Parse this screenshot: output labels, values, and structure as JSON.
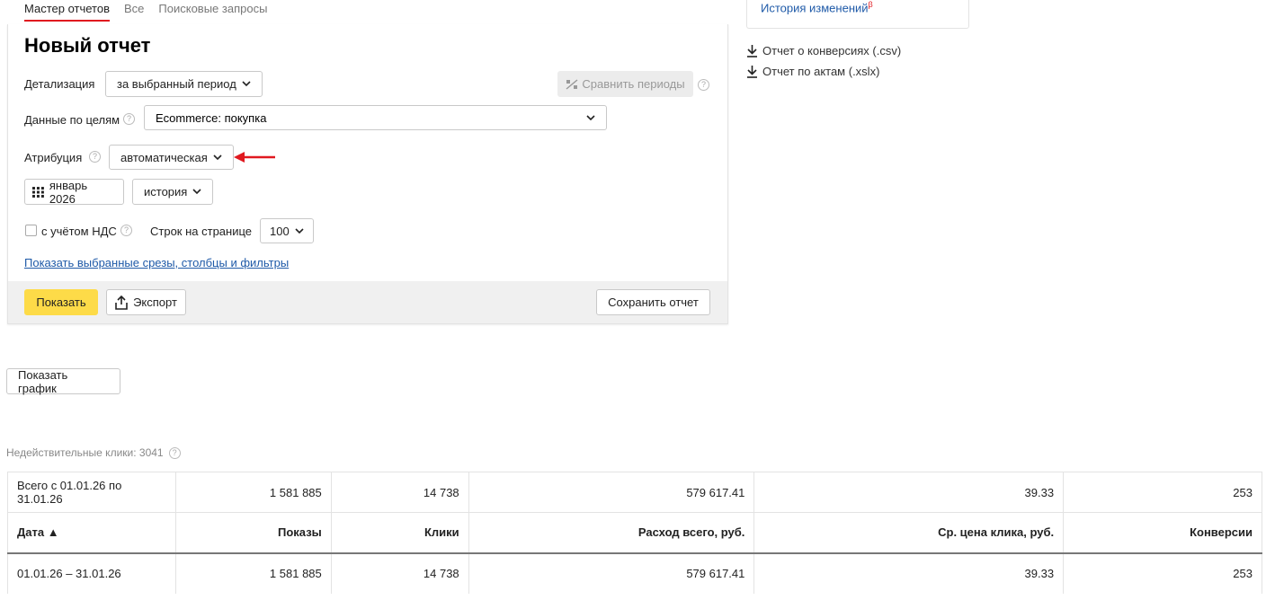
{
  "tabs": [
    {
      "label": "Мастер отчетов",
      "active": true
    },
    {
      "label": "Все",
      "active": false
    },
    {
      "label": "Поисковые запросы",
      "active": false
    }
  ],
  "report": {
    "title": "Новый отчет",
    "detail_label": "Детализация",
    "detail_value": "за выбранный период",
    "compare_label": "Сравнить периоды",
    "goals_label": "Данные по целям",
    "goals_value": "Ecommerce: покупка",
    "attribution_label": "Атрибуция",
    "attribution_value": "автоматическая",
    "period_label": "январь 2026",
    "history_value": "история",
    "vat_label": "с учётом НДС",
    "rows_label": "Строк на странице",
    "rows_value": "100",
    "show_slices_link": "Показать выбранные срезы, столбцы и фильтры",
    "show_button": "Показать",
    "export_button": "Экспорт",
    "save_button": "Сохранить отчет"
  },
  "sidebar": {
    "history_link": "История изменений",
    "history_badge": "β",
    "downloads": [
      "Отчет о конверсиях (.csv)",
      "Отчет по актам (.xslx)"
    ]
  },
  "show_chart_button": "Показать график",
  "invalid_clicks": "Недействительные клики: 3041",
  "table": {
    "total_row": [
      "Всего с 01.01.26 по 31.01.26",
      "1 581 885",
      "14 738",
      "579 617.41",
      "39.33",
      "253"
    ],
    "headers": [
      "Дата ▲",
      "Показы",
      "Клики",
      "Расход всего, руб.",
      "Ср. цена клика, руб.",
      "Конверсии"
    ],
    "rows": [
      [
        "01.01.26 – 31.01.26",
        "1 581 885",
        "14 738",
        "579 617.41",
        "39.33",
        "253"
      ]
    ]
  },
  "colors": {
    "accent_tab": "#e0191f",
    "primary_button": "#fddb48",
    "link": "#1f5aa8",
    "arrow": "#e0191f"
  }
}
